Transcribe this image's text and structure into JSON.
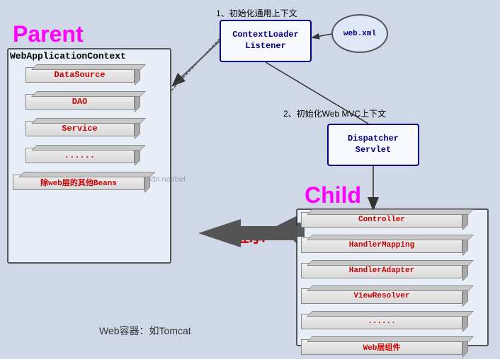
{
  "parent_label": "Parent",
  "child_label": "Child",
  "wac_title": "WebApplicationContext",
  "parent_stacks": [
    {
      "label": "DataSource"
    },
    {
      "label": "DAO"
    },
    {
      "label": "Service"
    },
    {
      "label": "......"
    },
    {
      "label": "除web层的其他Beans"
    }
  ],
  "child_stacks": [
    {
      "label": "Controller"
    },
    {
      "label": "HandlerMapping"
    },
    {
      "label": "HandlerAdapter"
    },
    {
      "label": "ViewResolver"
    },
    {
      "label": "......"
    },
    {
      "label": "Web层组件"
    }
  ],
  "cll_label": "ContextLoader\nListener",
  "webxml_label": "web.xml",
  "ds_label": "Dispatcher\nServlet",
  "label_init1": "1、初始化通用上下文",
  "label_init2": "2、初始化Web MVC上下文",
  "inherit_label": "继承",
  "webcontainer_label": "Web容器：如Tomcat",
  "watermark": "tp://blog.csdn.net/bel"
}
